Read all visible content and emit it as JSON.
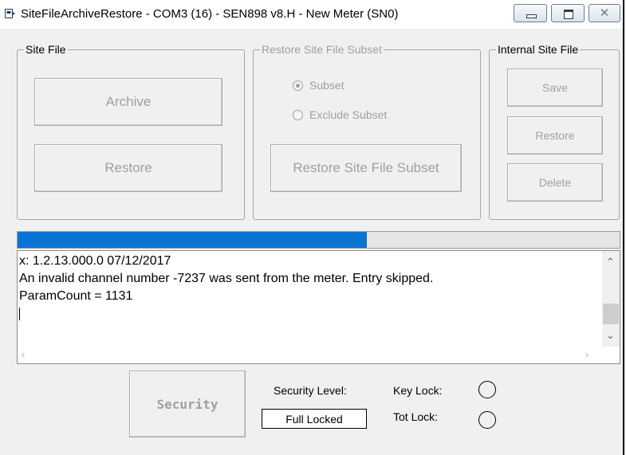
{
  "window": {
    "title": "SiteFileArchiveRestore - COM3 (16) - SEN898 v8.H - New Meter (SN0)",
    "controls": {
      "minimize": "minimize",
      "maximize": "maximize",
      "close": "✕"
    }
  },
  "site_file": {
    "label": "Site File",
    "archive_label": "Archive",
    "restore_label": "Restore"
  },
  "subset": {
    "label": "Restore Site File Subset",
    "options": [
      {
        "label": "Subset",
        "selected": true
      },
      {
        "label": "Exclude Subset",
        "selected": false
      }
    ],
    "button_label": "Restore Site File Subset"
  },
  "internal": {
    "label": "Internal Site File",
    "save_label": "Save",
    "restore_label": "Restore",
    "delete_label": "Delete"
  },
  "progress": {
    "fraction": 0.58,
    "color": "#0a74d4"
  },
  "log": {
    "lines": [
      "x: 1.2.13.000.0 07/12/2017",
      "An invalid channel number -7237 was sent from the meter. Entry skipped.",
      "ParamCount = 1131"
    ]
  },
  "security": {
    "button_label": "Security",
    "level_label": "Security Level:",
    "level_value": "Full Locked",
    "key_lock_label": "Key Lock:",
    "tot_lock_label": "Tot Lock:"
  }
}
